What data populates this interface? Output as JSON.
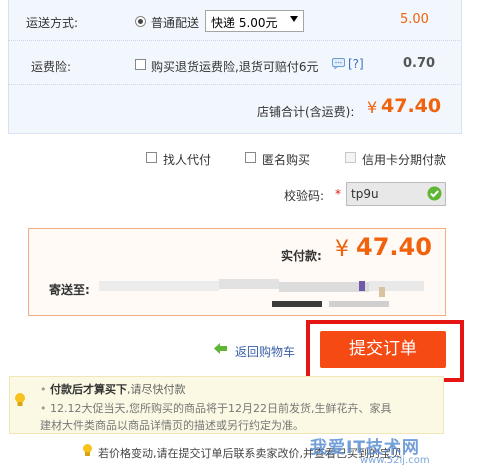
{
  "shipping": {
    "label": "运送方式:",
    "option_label": "普通配送",
    "select_value": "快递 5.00元",
    "price": "5.00"
  },
  "insurance": {
    "label": "运费险:",
    "checkbox_label": "购买退货运费险,退货可赔付6元",
    "help": "[?]",
    "price": "0.70"
  },
  "store_total": {
    "label": "店铺合计(含运费):",
    "currency": "¥",
    "value": "47.40"
  },
  "options": {
    "proxy_pay": "找人代付",
    "anonymous": "匿名购买",
    "installments": "信用卡分期付款"
  },
  "captcha": {
    "label": "校验码:",
    "required_mark": "*",
    "value": "tp9u"
  },
  "payment": {
    "label": "实付款:",
    "currency": "¥",
    "value": "47.40",
    "ship_to_label": "寄送至:"
  },
  "actions": {
    "back_label": "返回购物车",
    "submit_label": "提交订单"
  },
  "tips": {
    "line1_bold": "付款后才算买下",
    "line1_rest": ",请尽快付款",
    "line2": "12.12大促当天,您所购买的商品将于12月22日前发货,生鲜花卉、家具",
    "line3": "建材大件类商品以商品详情页的描述或另行约定为准。",
    "footer": "若价格变动,请在提交订单后联系卖家改价,并查看已买到的宝贝"
  },
  "watermark": {
    "text": "我爱IT技术网",
    "url": "www.52ij.com"
  },
  "colors": {
    "accent_orange": "#f0620c",
    "submit_bg": "#f54a13",
    "highlight_red": "#e41512"
  }
}
